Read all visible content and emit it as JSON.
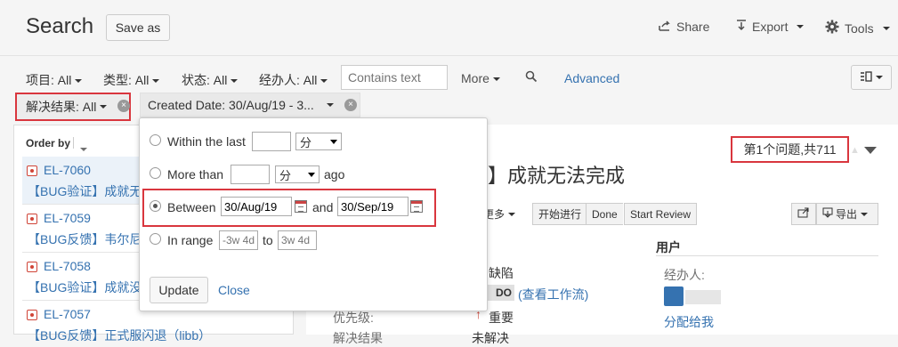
{
  "header": {
    "title": "Search",
    "save_as": "Save as",
    "share": "Share",
    "export": "Export",
    "tools": "Tools"
  },
  "filters": {
    "project": "项目: All",
    "type": "类型: All",
    "status": "状态: All",
    "assignee": "经办人: All",
    "search_placeholder": "Contains text",
    "more": "More",
    "advanced": "Advanced",
    "resolution": "解决结果: All",
    "created": "Created Date: 30/Aug/19 - 3..."
  },
  "list": {
    "order_by": "Order by",
    "issues": [
      {
        "key": "EL-7060",
        "summary": "【BUG验证】成就无"
      },
      {
        "key": "EL-7059",
        "summary": "【BUG反馈】韦尔尼"
      },
      {
        "key": "EL-7058",
        "summary": "【BUG验证】成就没"
      },
      {
        "key": "EL-7057",
        "summary": "【BUG反馈】正式服闪退（libb）"
      }
    ]
  },
  "popup": {
    "within_last": "Within the last",
    "more_than": "More than",
    "ago": "ago",
    "between": "Between",
    "and": "and",
    "date_from": "30/Aug/19",
    "date_to": "30/Sep/19",
    "in_range": "In range",
    "to": "to",
    "range_from_placeholder": "-3w 4d",
    "range_to_placeholder": "3w 4d",
    "unit_1": "分",
    "unit_2": "分",
    "update": "Update",
    "close": "Close",
    "selected_option": "between"
  },
  "detail": {
    "issue_count": "第1个问题,共711",
    "title": "】成就无法完成",
    "more_actions": "更多",
    "start_progress": "开始进行",
    "done": "Done",
    "start_review": "Start Review",
    "export": "导出",
    "users_title": "用户",
    "assignee_label": "经办人:",
    "assign_to_me": "分配给我",
    "type_value": "缺陷",
    "status_value": "DO",
    "workflow_link": "(查看工作流)",
    "priority_label": "优先级:",
    "priority_value": "重要",
    "resolution_label": "解决结果",
    "resolution_value": "未解决"
  },
  "colors": {
    "link": "#3572b0",
    "highlight_border": "#d9363e",
    "bug_red": "#d04437"
  }
}
